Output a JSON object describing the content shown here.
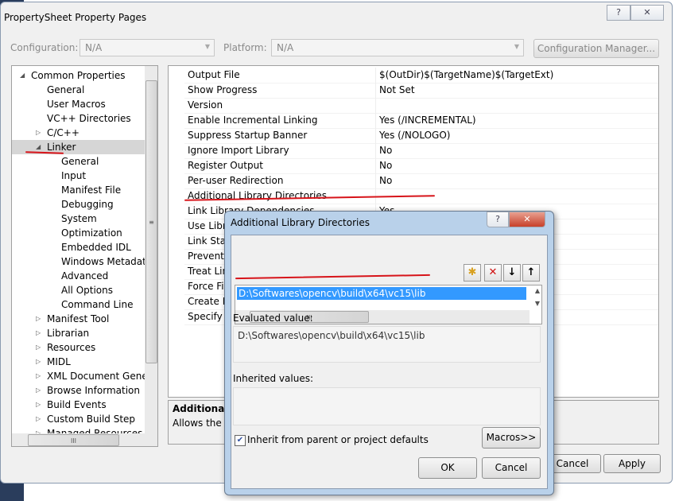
{
  "window": {
    "title": "PropertySheet Property Pages",
    "help_icon": "question-icon",
    "close_icon": "close-icon"
  },
  "toolbar": {
    "configuration_label": "Configuration:",
    "configuration_value": "N/A",
    "platform_label": "Platform:",
    "platform_value": "N/A",
    "config_manager": "Configuration Manager..."
  },
  "tree": [
    {
      "label": "Common Properties",
      "level": 0,
      "expander": "expanded"
    },
    {
      "label": "General",
      "level": 1
    },
    {
      "label": "User Macros",
      "level": 1
    },
    {
      "label": "VC++ Directories",
      "level": 1
    },
    {
      "label": "C/C++",
      "level": 1,
      "expander": "collapsed"
    },
    {
      "label": "Linker",
      "level": 1,
      "expander": "expanded",
      "selected": true
    },
    {
      "label": "General",
      "level": 2
    },
    {
      "label": "Input",
      "level": 2
    },
    {
      "label": "Manifest File",
      "level": 2
    },
    {
      "label": "Debugging",
      "level": 2
    },
    {
      "label": "System",
      "level": 2
    },
    {
      "label": "Optimization",
      "level": 2
    },
    {
      "label": "Embedded IDL",
      "level": 2
    },
    {
      "label": "Windows Metadata",
      "level": 2
    },
    {
      "label": "Advanced",
      "level": 2
    },
    {
      "label": "All Options",
      "level": 2
    },
    {
      "label": "Command Line",
      "level": 2
    },
    {
      "label": "Manifest Tool",
      "level": 1,
      "expander": "collapsed"
    },
    {
      "label": "Librarian",
      "level": 1,
      "expander": "collapsed"
    },
    {
      "label": "Resources",
      "level": 1,
      "expander": "collapsed"
    },
    {
      "label": "MIDL",
      "level": 1,
      "expander": "collapsed"
    },
    {
      "label": "XML Document Genera",
      "level": 1,
      "expander": "collapsed"
    },
    {
      "label": "Browse Information",
      "level": 1,
      "expander": "collapsed"
    },
    {
      "label": "Build Events",
      "level": 1,
      "expander": "collapsed"
    },
    {
      "label": "Custom Build Step",
      "level": 1,
      "expander": "collapsed"
    },
    {
      "label": "Managed Resources",
      "level": 1,
      "expander": "collapsed"
    }
  ],
  "properties": [
    {
      "name": "Output File",
      "value": "$(OutDir)$(TargetName)$(TargetExt)"
    },
    {
      "name": "Show Progress",
      "value": "Not Set"
    },
    {
      "name": "Version",
      "value": ""
    },
    {
      "name": "Enable Incremental Linking",
      "value": "Yes (/INCREMENTAL)"
    },
    {
      "name": "Suppress Startup Banner",
      "value": "Yes (/NOLOGO)"
    },
    {
      "name": "Ignore Import Library",
      "value": "No"
    },
    {
      "name": "Register Output",
      "value": "No"
    },
    {
      "name": "Per-user Redirection",
      "value": "No"
    },
    {
      "name": "Additional Library Directories",
      "value": ""
    },
    {
      "name": "Link Library Dependencies",
      "value": "Yes"
    },
    {
      "name": "Use Libra",
      "value": ""
    },
    {
      "name": "Link Stat",
      "value": ""
    },
    {
      "name": "Prevent I",
      "value": ""
    },
    {
      "name": "Treat Lin",
      "value": ""
    },
    {
      "name": "Force Fil",
      "value": ""
    },
    {
      "name": "Create H",
      "value": ""
    },
    {
      "name": "Specify S",
      "value": ""
    }
  ],
  "description": {
    "title": "Additional L",
    "text": "Allows the u"
  },
  "footer": {
    "cancel": "Cancel",
    "apply": "Apply"
  },
  "dialog": {
    "title": "Additional Library Directories",
    "toolbar_icons": [
      "new-folder-icon",
      "delete-icon",
      "move-down-icon",
      "move-up-icon"
    ],
    "entries": [
      "D:\\Softwares\\opencv\\build\\x64\\vc15\\lib"
    ],
    "evaluated_label": "Evaluated value:",
    "evaluated_value": "D:\\Softwares\\opencv\\build\\x64\\vc15\\lib",
    "inherited_label": "Inherited values:",
    "inherit_checkbox": "Inherit from parent or project defaults",
    "inherit_checked": true,
    "macros": "Macros>>",
    "ok": "OK",
    "cancel": "Cancel"
  },
  "colors": {
    "selection": "#3399ff",
    "annotation": "#d7141a",
    "dialog_frame": "#b9d1ea"
  }
}
